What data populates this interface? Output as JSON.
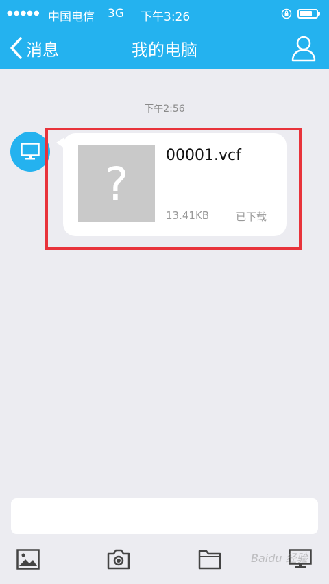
{
  "status_bar": {
    "signal": "●●●●●",
    "carrier": "中国电信",
    "network": "3G",
    "time": "下午3:26",
    "battery_level": 0.8
  },
  "nav": {
    "back_label": "消息",
    "title": "我的电脑",
    "back_icon": "chevron-left-icon",
    "profile_icon": "person-icon"
  },
  "chat": {
    "timestamp": "下午2:56",
    "sender_icon": "computer-icon",
    "message": {
      "file_name": "00001.vcf",
      "file_size": "13.41KB",
      "file_status": "已下载",
      "thumbnail_glyph": "?"
    }
  },
  "toolbar": {
    "icons": [
      "image-icon",
      "camera-icon",
      "folder-icon",
      "computer-icon"
    ]
  },
  "watermark": "Baidu 经验",
  "colors": {
    "header": "#24b2ef",
    "background": "#ececf1",
    "highlight": "#e8333b"
  }
}
